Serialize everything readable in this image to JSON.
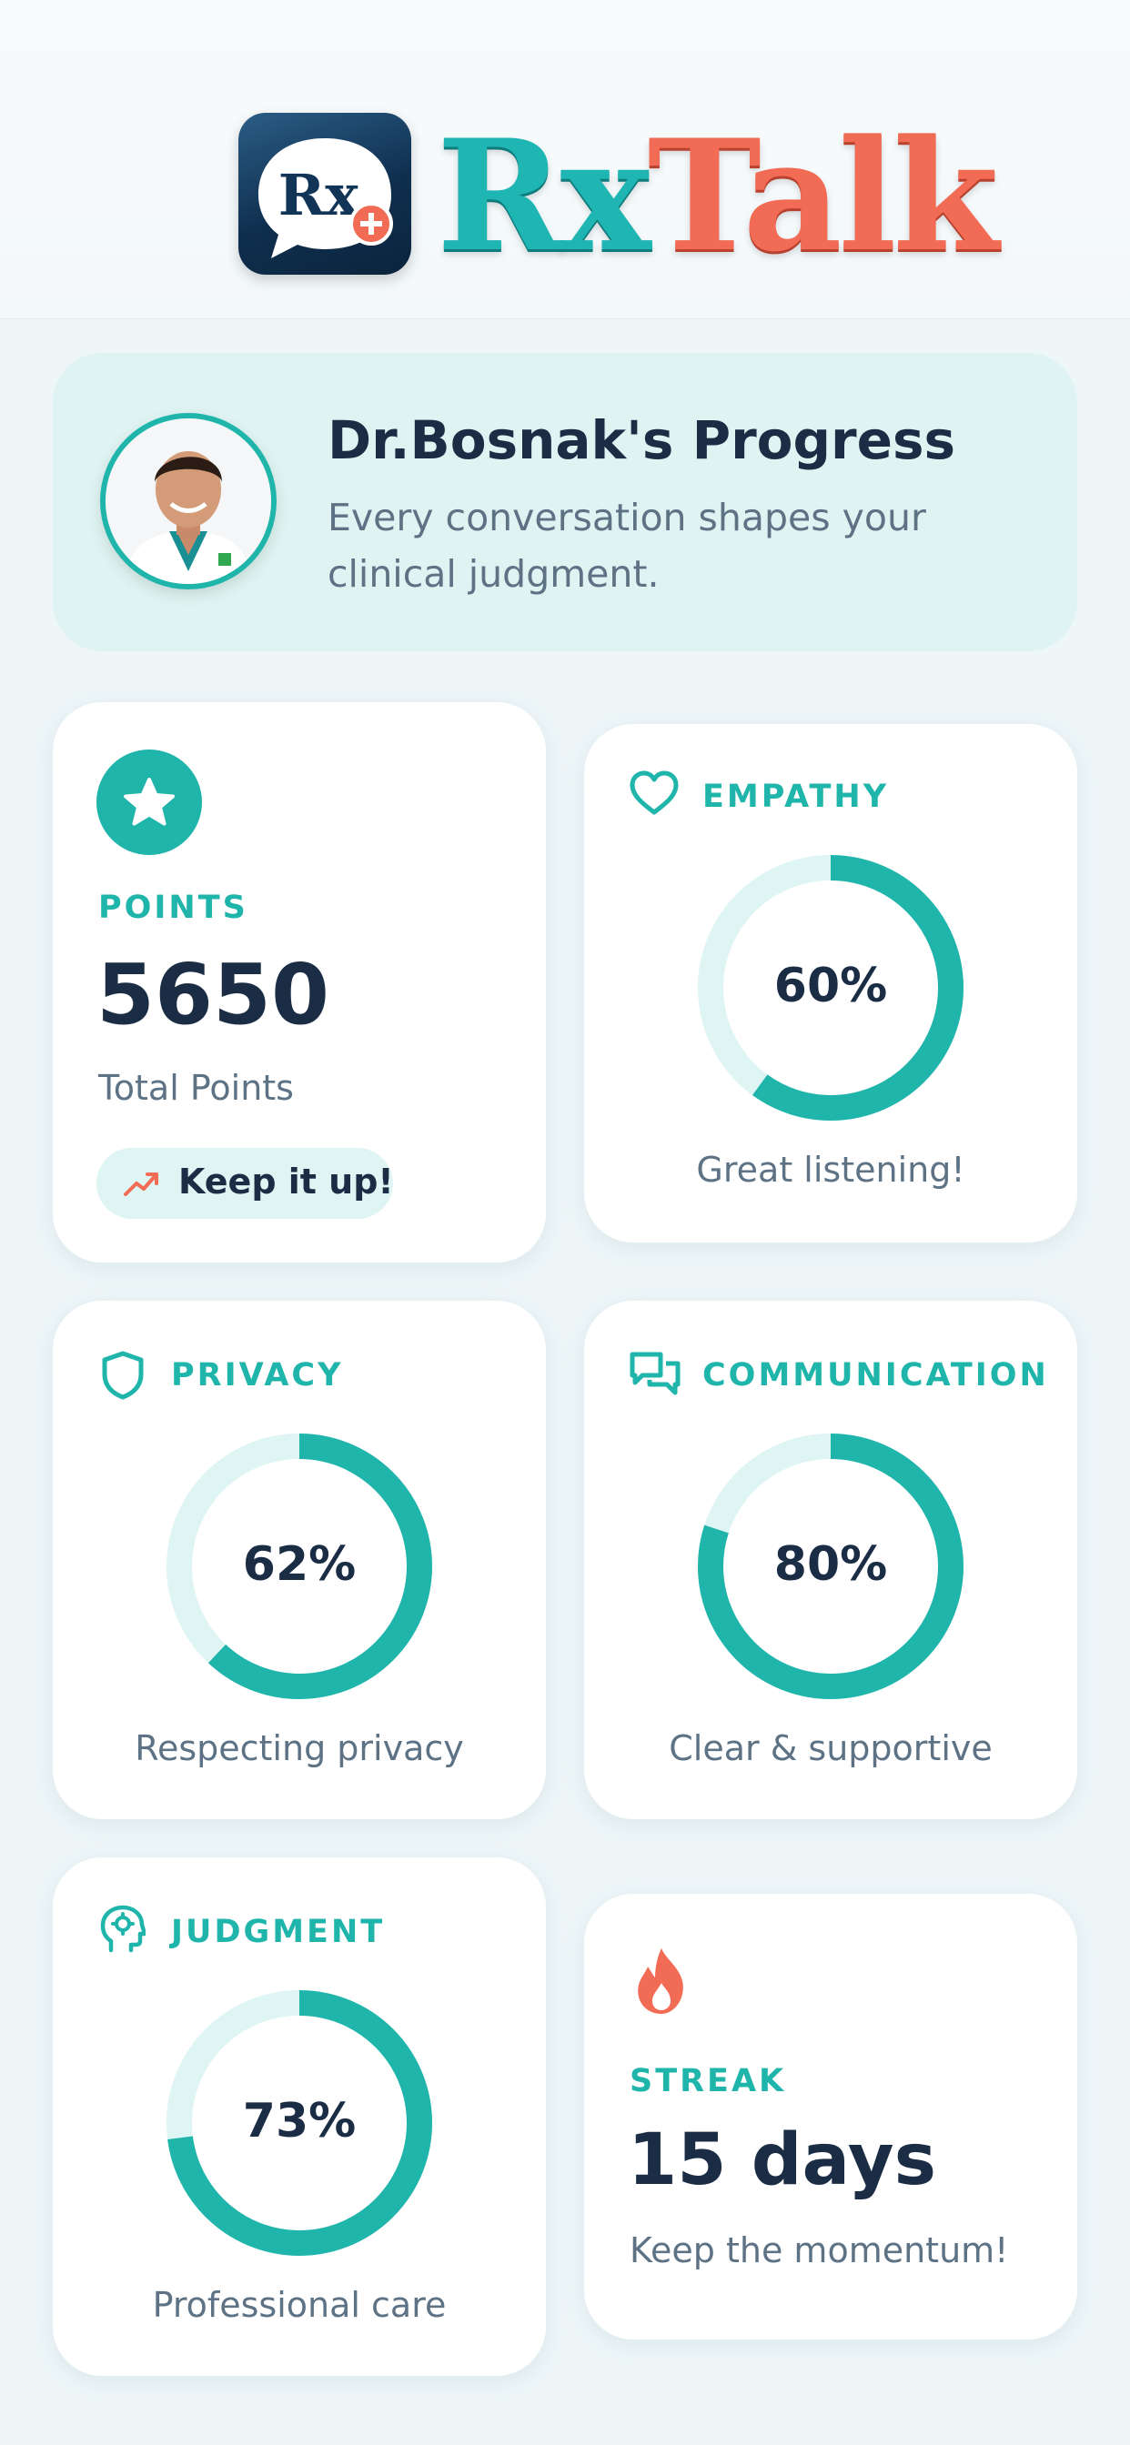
{
  "header": {
    "logo_rx": "Rx",
    "logo_talk": "Talk",
    "logo_mark_text": "Rx"
  },
  "profile": {
    "title": "Dr.Bosnak's Progress",
    "subtitle": "Every conversation shapes your clinical judgment."
  },
  "points": {
    "label": "POINTS",
    "value": "5650",
    "caption": "Total Points",
    "badge": "Keep it up!"
  },
  "metrics": {
    "empathy": {
      "label": "EMPATHY",
      "percent": 60,
      "percent_text": "60%",
      "caption": "Great listening!"
    },
    "privacy": {
      "label": "PRIVACY",
      "percent": 62,
      "percent_text": "62%",
      "caption": "Respecting privacy"
    },
    "communication": {
      "label": "COMMUNICATION",
      "percent": 80,
      "percent_text": "80%",
      "caption": "Clear & supportive"
    },
    "judgment": {
      "label": "JUDGMENT",
      "percent": 73,
      "percent_text": "73%",
      "caption": "Professional care"
    }
  },
  "streak": {
    "label": "STREAK",
    "value": "15 days",
    "caption": "Keep the momentum!"
  },
  "colors": {
    "accent": "#1fb5ab",
    "accent_light": "#dff5f3",
    "dark": "#1b2d45",
    "muted": "#5d7385",
    "flame": "#f26b55"
  },
  "icons": [
    "star-icon",
    "trending-up-icon",
    "heart-icon",
    "shield-icon",
    "chat-icon",
    "brain-head-icon",
    "flame-icon"
  ]
}
